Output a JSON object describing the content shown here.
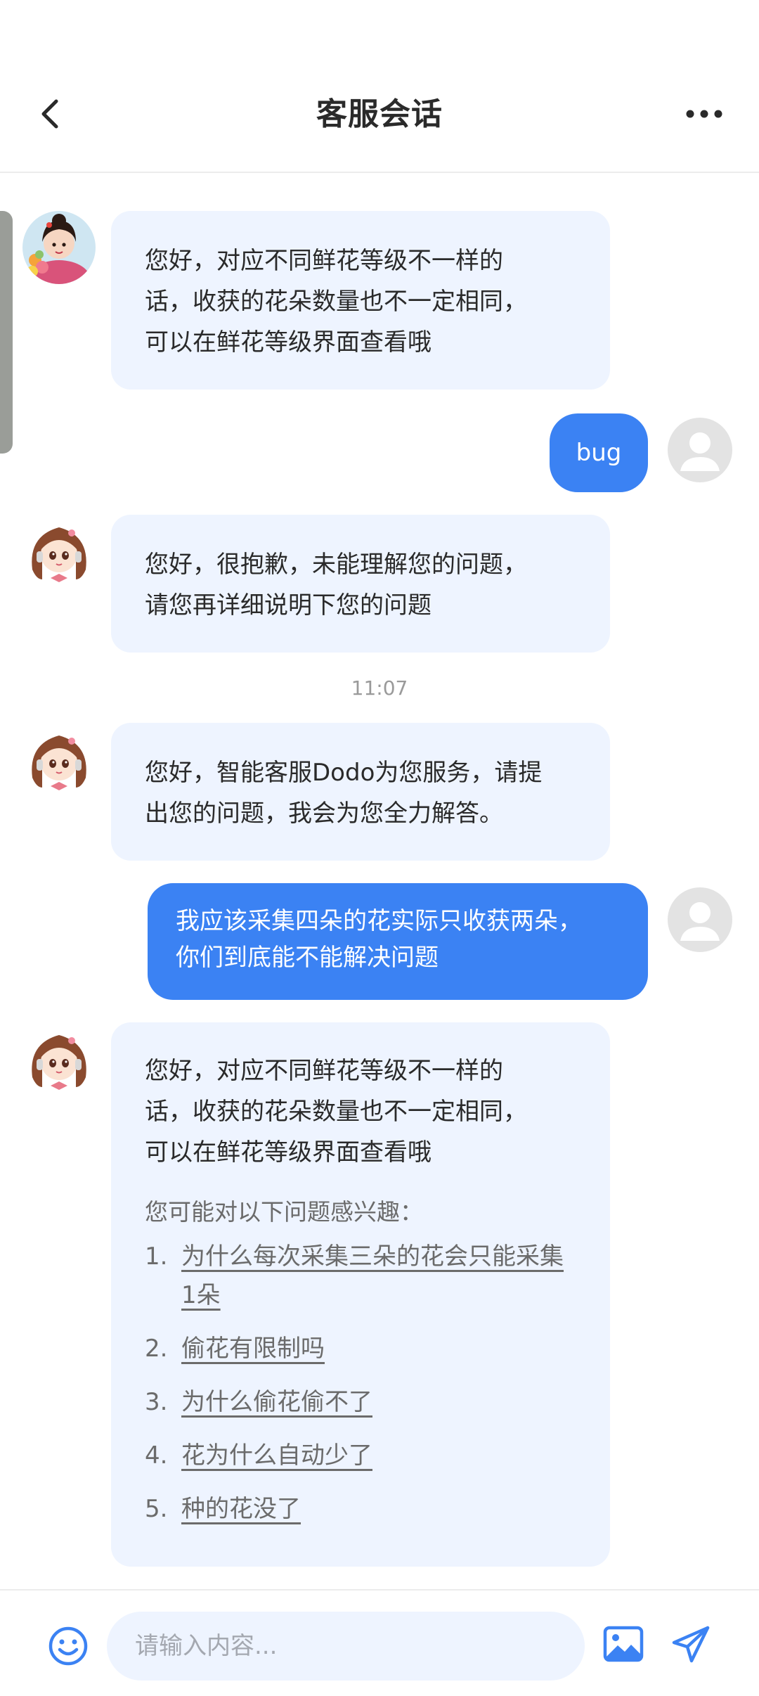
{
  "header": {
    "title": "客服会话",
    "back_icon": "chevron-left-icon",
    "more_icon": "more-horizontal-icon"
  },
  "messages": [
    {
      "from": "agent",
      "avatar": "girl-with-flowers-avatar",
      "lines": [
        "您好，对应不同鲜花等级不一样的",
        "话，收获的花朵数量也不一定相同，",
        "可以在鲜花等级界面查看哦"
      ]
    },
    {
      "from": "user",
      "avatar": "default-user-avatar",
      "text": "bug"
    },
    {
      "from": "agent",
      "avatar": "headset-girl-avatar",
      "lines": [
        "您好，很抱歉，未能理解您的问题，",
        "请您再详细说明下您的问题"
      ]
    },
    {
      "from": "agent",
      "avatar": "headset-girl-avatar",
      "lines": [
        "您好，智能客服Dodo为您服务，请提",
        "出您的问题，我会为您全力解答。"
      ]
    },
    {
      "from": "user",
      "avatar": "default-user-avatar",
      "lines": [
        "我应该采集四朵的花实际只收获两朵，",
        "你们到底能不能解决问题"
      ]
    },
    {
      "from": "agent",
      "avatar": "headset-girl-avatar",
      "lines": [
        "您好，对应不同鲜花等级不一样的",
        "话，收获的花朵数量也不一定相同，",
        "可以在鲜花等级界面查看哦"
      ],
      "suggest_title": "您可能对以下问题感兴趣：",
      "suggestions": [
        {
          "num": "1.",
          "text": "为什么每次采集三朵的花会只能采集1朵"
        },
        {
          "num": "2.",
          "text": "偷花有限制吗"
        },
        {
          "num": "3.",
          "text": "为什么偷花偷不了"
        },
        {
          "num": "4.",
          "text": "花为什么自动少了"
        },
        {
          "num": "5.",
          "text": "种的花没了"
        }
      ]
    }
  ],
  "timestamp": "11:07",
  "footer": {
    "placeholder": "请输入内容...",
    "emoji_icon": "smiley-icon",
    "image_icon": "image-icon",
    "send_icon": "send-icon"
  },
  "colors": {
    "agent_bubble": "#eef4ff",
    "user_bubble": "#3b82f3",
    "accent": "#3b82f3"
  }
}
